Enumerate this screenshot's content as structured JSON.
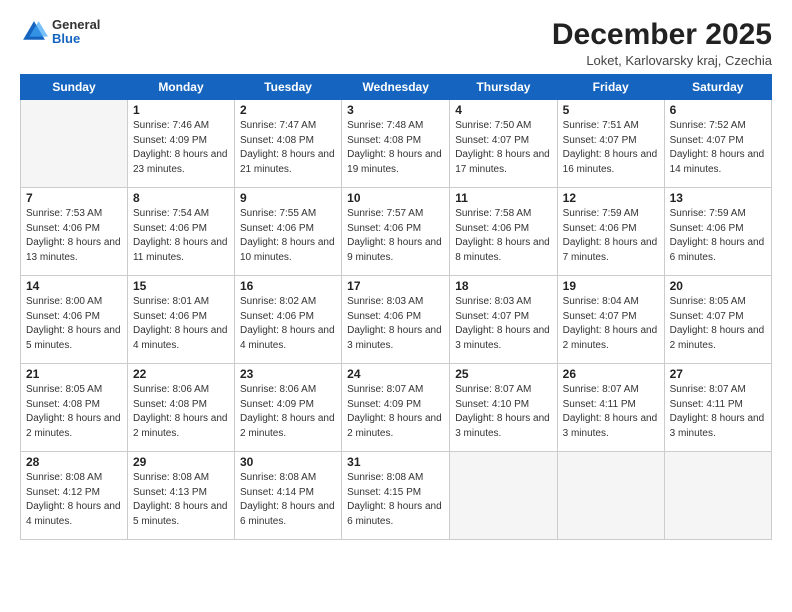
{
  "logo": {
    "general": "General",
    "blue": "Blue"
  },
  "title": "December 2025",
  "subtitle": "Loket, Karlovarsky kraj, Czechia",
  "days_of_week": [
    "Sunday",
    "Monday",
    "Tuesday",
    "Wednesday",
    "Thursday",
    "Friday",
    "Saturday"
  ],
  "weeks": [
    [
      {
        "num": "",
        "empty": true
      },
      {
        "num": "1",
        "sunrise": "7:46 AM",
        "sunset": "4:09 PM",
        "daylight": "8 hours and 23 minutes."
      },
      {
        "num": "2",
        "sunrise": "7:47 AM",
        "sunset": "4:08 PM",
        "daylight": "8 hours and 21 minutes."
      },
      {
        "num": "3",
        "sunrise": "7:48 AM",
        "sunset": "4:08 PM",
        "daylight": "8 hours and 19 minutes."
      },
      {
        "num": "4",
        "sunrise": "7:50 AM",
        "sunset": "4:07 PM",
        "daylight": "8 hours and 17 minutes."
      },
      {
        "num": "5",
        "sunrise": "7:51 AM",
        "sunset": "4:07 PM",
        "daylight": "8 hours and 16 minutes."
      },
      {
        "num": "6",
        "sunrise": "7:52 AM",
        "sunset": "4:07 PM",
        "daylight": "8 hours and 14 minutes."
      }
    ],
    [
      {
        "num": "7",
        "sunrise": "7:53 AM",
        "sunset": "4:06 PM",
        "daylight": "8 hours and 13 minutes."
      },
      {
        "num": "8",
        "sunrise": "7:54 AM",
        "sunset": "4:06 PM",
        "daylight": "8 hours and 11 minutes."
      },
      {
        "num": "9",
        "sunrise": "7:55 AM",
        "sunset": "4:06 PM",
        "daylight": "8 hours and 10 minutes."
      },
      {
        "num": "10",
        "sunrise": "7:57 AM",
        "sunset": "4:06 PM",
        "daylight": "8 hours and 9 minutes."
      },
      {
        "num": "11",
        "sunrise": "7:58 AM",
        "sunset": "4:06 PM",
        "daylight": "8 hours and 8 minutes."
      },
      {
        "num": "12",
        "sunrise": "7:59 AM",
        "sunset": "4:06 PM",
        "daylight": "8 hours and 7 minutes."
      },
      {
        "num": "13",
        "sunrise": "7:59 AM",
        "sunset": "4:06 PM",
        "daylight": "8 hours and 6 minutes."
      }
    ],
    [
      {
        "num": "14",
        "sunrise": "8:00 AM",
        "sunset": "4:06 PM",
        "daylight": "8 hours and 5 minutes."
      },
      {
        "num": "15",
        "sunrise": "8:01 AM",
        "sunset": "4:06 PM",
        "daylight": "8 hours and 4 minutes."
      },
      {
        "num": "16",
        "sunrise": "8:02 AM",
        "sunset": "4:06 PM",
        "daylight": "8 hours and 4 minutes."
      },
      {
        "num": "17",
        "sunrise": "8:03 AM",
        "sunset": "4:06 PM",
        "daylight": "8 hours and 3 minutes."
      },
      {
        "num": "18",
        "sunrise": "8:03 AM",
        "sunset": "4:07 PM",
        "daylight": "8 hours and 3 minutes."
      },
      {
        "num": "19",
        "sunrise": "8:04 AM",
        "sunset": "4:07 PM",
        "daylight": "8 hours and 2 minutes."
      },
      {
        "num": "20",
        "sunrise": "8:05 AM",
        "sunset": "4:07 PM",
        "daylight": "8 hours and 2 minutes."
      }
    ],
    [
      {
        "num": "21",
        "sunrise": "8:05 AM",
        "sunset": "4:08 PM",
        "daylight": "8 hours and 2 minutes."
      },
      {
        "num": "22",
        "sunrise": "8:06 AM",
        "sunset": "4:08 PM",
        "daylight": "8 hours and 2 minutes."
      },
      {
        "num": "23",
        "sunrise": "8:06 AM",
        "sunset": "4:09 PM",
        "daylight": "8 hours and 2 minutes."
      },
      {
        "num": "24",
        "sunrise": "8:07 AM",
        "sunset": "4:09 PM",
        "daylight": "8 hours and 2 minutes."
      },
      {
        "num": "25",
        "sunrise": "8:07 AM",
        "sunset": "4:10 PM",
        "daylight": "8 hours and 3 minutes."
      },
      {
        "num": "26",
        "sunrise": "8:07 AM",
        "sunset": "4:11 PM",
        "daylight": "8 hours and 3 minutes."
      },
      {
        "num": "27",
        "sunrise": "8:07 AM",
        "sunset": "4:11 PM",
        "daylight": "8 hours and 3 minutes."
      }
    ],
    [
      {
        "num": "28",
        "sunrise": "8:08 AM",
        "sunset": "4:12 PM",
        "daylight": "8 hours and 4 minutes."
      },
      {
        "num": "29",
        "sunrise": "8:08 AM",
        "sunset": "4:13 PM",
        "daylight": "8 hours and 5 minutes."
      },
      {
        "num": "30",
        "sunrise": "8:08 AM",
        "sunset": "4:14 PM",
        "daylight": "8 hours and 6 minutes."
      },
      {
        "num": "31",
        "sunrise": "8:08 AM",
        "sunset": "4:15 PM",
        "daylight": "8 hours and 6 minutes."
      },
      {
        "num": "",
        "empty": true
      },
      {
        "num": "",
        "empty": true
      },
      {
        "num": "",
        "empty": true
      }
    ]
  ]
}
